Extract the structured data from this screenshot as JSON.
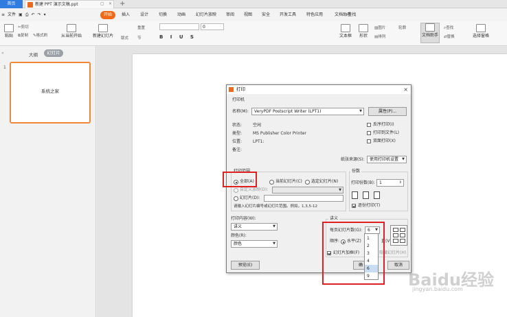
{
  "titlebar": {
    "home_tab": "首页",
    "doc_tab": "新建 PPT 演示文稿.ppt"
  },
  "menu": {
    "file": "文件",
    "items": [
      "开始",
      "插入",
      "设计",
      "切换",
      "动画",
      "幻灯片放映",
      "审阅",
      "视图",
      "安全",
      "开发工具",
      "特色应用",
      "文档助手"
    ],
    "search": "查找"
  },
  "ribbon": {
    "paste": "粘贴",
    "cut": "剪切",
    "copy": "复制",
    "format_painter": "格式刷",
    "from_current": "从当前开始",
    "new_slide": "新建幻灯片",
    "layout": "版式",
    "section": "节",
    "reset": "重置",
    "font_size": "0",
    "textbox": "文本框",
    "shapes": "形状",
    "arrange": "排列",
    "picture": "图片",
    "outline": "轮廓",
    "doc_assistant": "文档助手",
    "find": "查找",
    "replace": "替换",
    "select_pane": "选择窗格"
  },
  "left_panel": {
    "outline_tab": "大纲",
    "slides_tab": "幻灯片",
    "slide_number": "1",
    "slide_title": "系统之家"
  },
  "dialog": {
    "title": "打印",
    "printer_section": "打印机",
    "name_label": "名称(M):",
    "printer_name": "VeryPDF Postscript Writer (LPT1)",
    "properties_btn": "属性(P)...",
    "status_label": "状态:",
    "status_value": "空闲",
    "type_label": "类型:",
    "type_value": "MS Publisher Color Printer",
    "where_label": "位置:",
    "where_value": "LPT1:",
    "comment_label": "备注:",
    "reverse": "反序打印(I)",
    "print_to_file": "打印到文件(L)",
    "duplex": "双面打印(X)",
    "paper_source_label": "纸张来源(S):",
    "paper_source_value": "使用打印机设置",
    "range_section": "打印范围",
    "range_all": "全部(A)",
    "range_current": "当前幻灯片(C)",
    "range_selection": "选定幻灯片(N)",
    "range_custom": "自定义放映(D):",
    "range_slides": "幻灯片(D):",
    "range_hint": "请输入幻灯片编号或幻灯片范围。例如，1,3,5-12",
    "copies_section": "份数",
    "copies_label": "打印份数(B):",
    "copies_value": "1",
    "collate": "逐份打印(T)",
    "content_label": "打印内容(W):",
    "content_value": "讲义",
    "color_label": "颜色(R):",
    "color_value": "颜色",
    "handout_section": "讲义",
    "per_page_label": "每页幻灯片数(G):",
    "per_page_value": "6",
    "order_label": "顺序:",
    "order_horizontal": "水平(Z)",
    "order_vertical_suffix": "直(V)",
    "frame_slides": "幻灯片加框(F)",
    "print_hidden": "隐藏幻灯片(H)",
    "preview_btn": "预览(E)",
    "ok_btn": "确",
    "cancel_btn": "取消",
    "dropdown_options": [
      "1",
      "2",
      "3",
      "4",
      "6",
      "9"
    ],
    "dropdown_selected": "6"
  },
  "watermark": {
    "main": "Baidu经验",
    "sub": "jingyan.baidu.com"
  },
  "colors": {
    "accent": "#f06a17",
    "highlight": "#e02020",
    "home_tab": "#2f7be0"
  }
}
